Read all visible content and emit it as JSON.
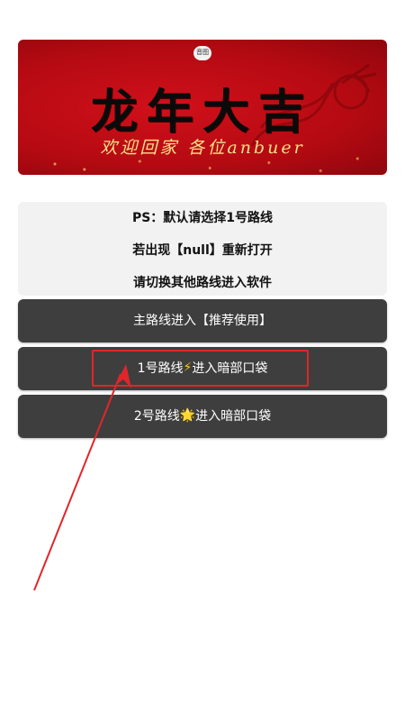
{
  "banner": {
    "badge": "音图",
    "title": "龙年大吉",
    "subtitle": "欢迎回家  各位anbuer"
  },
  "notice": {
    "line1": "PS：默认请选择1号路线",
    "line2": "若出现【null】重新打开",
    "line3": "请切换其他路线进入软件"
  },
  "routes": {
    "main": "主路线进入【推荐使用】",
    "route1_prefix": "1号路线",
    "route1_icon": "⚡",
    "route1_suffix": "进入暗部口袋",
    "route2_prefix": "2号路线",
    "route2_icon": "🌟",
    "route2_suffix": "进入暗部口袋"
  },
  "colors": {
    "banner_red": "#c40c14",
    "button_bg": "#3e3e3e",
    "notice_bg": "#f2f2f2",
    "annotation_red": "#e0262b"
  },
  "icons": {
    "route1": "lightning-bolt-icon",
    "route2": "glowing-star-icon"
  }
}
